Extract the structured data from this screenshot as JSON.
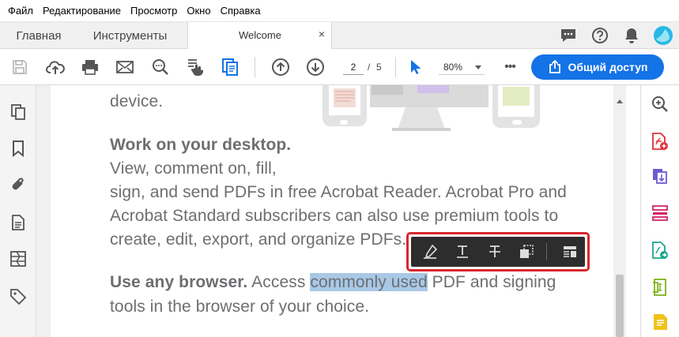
{
  "menu": [
    "Файл",
    "Редактирование",
    "Просмотр",
    "Окно",
    "Справка"
  ],
  "tabs": {
    "home": "Главная",
    "tools": "Инструменты",
    "document": "Welcome",
    "close": "×"
  },
  "toolbar": {
    "page_current": "2",
    "page_separator": "/",
    "page_total": "5",
    "zoom": "80%",
    "more": "•••",
    "share_label": "Общий доступ"
  },
  "document": {
    "line0": "device.",
    "heading1": "Work on your desktop.",
    "line1": "View, comment on, fill,",
    "line2": "sign, and send PDFs in free Acrobat Reader. Acrobat Pro and",
    "line3": "Acrobat Standard subscribers can also use premium tools to",
    "line4": "create, edit, export, and organize PDFs.",
    "heading2": "Use any browser.",
    "line5_pre": " Access ",
    "line5_hl": "commonly used",
    "line5_post": " PDF and signing",
    "line6": "tools in the browser of your choice."
  },
  "colors": {
    "accent": "#1473e6",
    "highlight": "#a8c8e6",
    "callout_border": "#d9262c",
    "float_toolbar_bg": "#2d2d2d"
  }
}
